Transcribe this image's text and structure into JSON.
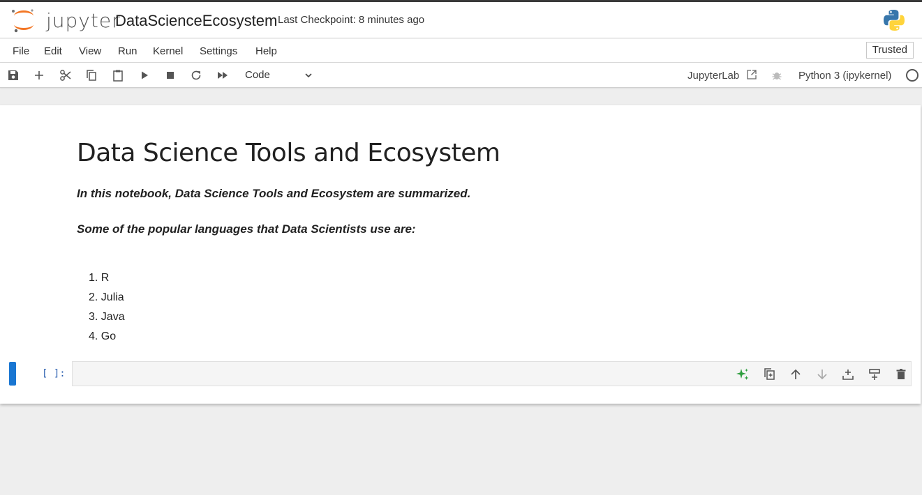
{
  "header": {
    "logo_text": "jupyter",
    "notebook_title": "DataScienceEcosystem",
    "checkpoint": "Last Checkpoint: 8 minutes ago"
  },
  "menu": {
    "items": [
      "File",
      "Edit",
      "View",
      "Run",
      "Kernel",
      "Settings",
      "Help"
    ],
    "trusted": "Trusted"
  },
  "toolbar": {
    "cell_type": "Code",
    "jupyterlab": "JupyterLab",
    "kernel": "Python 3 (ipykernel)"
  },
  "notebook": {
    "heading": "Data Science Tools and Ecosystem",
    "intro": "In this notebook, Data Science Tools and Ecosystem are summarized.",
    "languages_intro": "Some of the popular languages that Data Scientists use are:",
    "languages": [
      "1. R",
      "2. Julia",
      "3. Java",
      "4. Go"
    ],
    "code_prompt": "[ ]:"
  },
  "colors": {
    "accent": "#1976d2",
    "jupyter_orange": "#f37726",
    "ai_green": "#2e9e3e"
  }
}
